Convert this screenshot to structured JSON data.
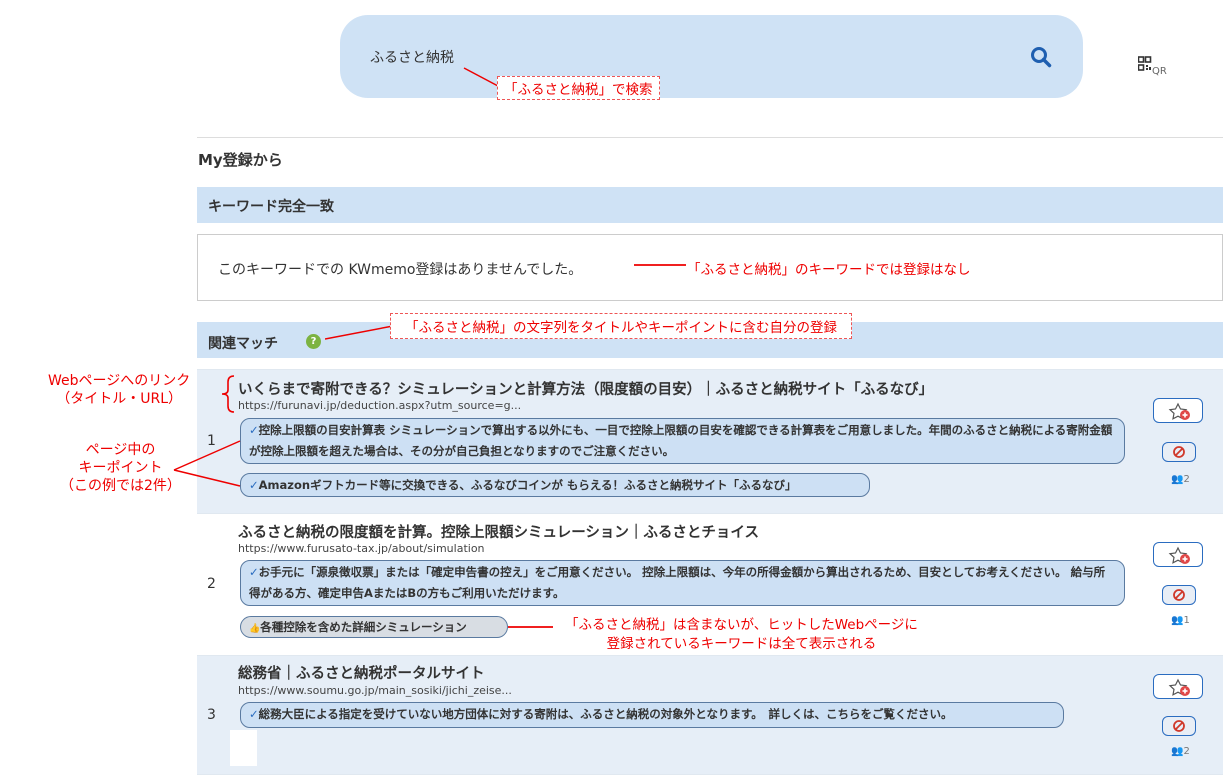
{
  "search": {
    "query": "ふるさと納税",
    "qr_label": "QR"
  },
  "annotations": {
    "search": "「ふるさと納税」で検索",
    "no_keyword": "「ふるさと納税」のキーワードでは登録はなし",
    "related": "「ふるさと納税」の文字列をタイトルやキーポイントに含む自分の登録",
    "link_line1": "Webページへのリンク",
    "link_line2": "（タイトル・URL）",
    "kp_line1": "ページ中の",
    "kp_line2": "キーポイント",
    "kp_line3": "（この例では2件）",
    "kw_line1": "「ふるさと納税」は含まないが、ヒットしたWebページに",
    "kw_line2": "登録されているキーワードは全て表示される"
  },
  "section_title": "My登録から",
  "exact_match": {
    "heading": "キーワード完全一致",
    "empty_message": "このキーワードでの KWmemo登録はありませんでした。"
  },
  "related_match": {
    "heading": "関連マッチ",
    "help_glyph": "?",
    "results": [
      {
        "number": "1",
        "title": "いくらまで寄附できる？シミュレーションと計算方法（限度額の目安）｜ふるさと納税サイト「ふるなび」",
        "url": "https://furunavi.jp/deduction.aspx?utm_source=g...",
        "keypoints": [
          "控除上限額の目安計算表 シミュレーションで算出する以外にも、一目で控除上限額の目安を確認できる計算表をご用意しました。年間のふるさと納税による寄附金額が控除上限額を超えた場合は、その分が自己負担となりますのでご注意ください。",
          "Amazonギフトカード等に交換できる、ふるなびコインが もらえる！ふるさと納税サイト「ふるなび」"
        ],
        "users": "2"
      },
      {
        "number": "2",
        "title": "ふるさと納税の限度額を計算。控除上限額シミュレーション｜ふるさとチョイス",
        "url": "https://www.furusato-tax.jp/about/simulation",
        "keypoints": [
          "お手元に「源泉徴収票」または「確定申告書の控え」をご用意ください。 控除上限額は、今年の所得金額から算出されるため、目安としてお考えください。 給与所得がある方、確定申告AまたはBの方もご利用いただけます。"
        ],
        "keyword_tag": "各種控除を含めた詳細シミュレーション",
        "users": "1"
      },
      {
        "number": "3",
        "title": "総務省｜ふるさと納税ポータルサイト",
        "url": "https://www.soumu.go.jp/main_sosiki/jichi_zeise...",
        "keypoints": [
          "総務大臣による指定を受けていない地方団体に対する寄附は、ふるさと納税の対象外となります。　詳しくは、こちらをご覧ください。"
        ],
        "users": "2"
      }
    ]
  },
  "icons": {
    "check": "✓",
    "thumb": "👍"
  },
  "colors": {
    "accent": "#2a6cc0",
    "annotation": "#e00000",
    "bar": "#cfe2f5"
  }
}
